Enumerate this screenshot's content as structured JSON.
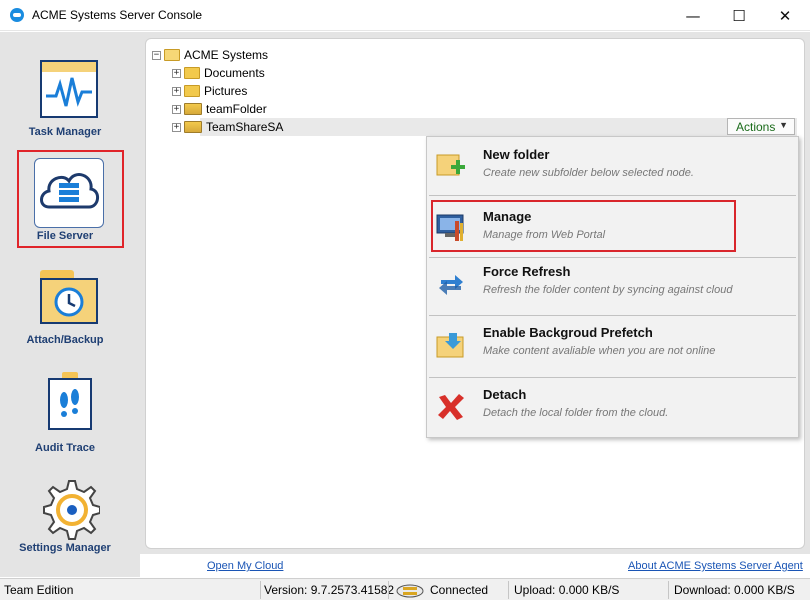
{
  "window": {
    "title": "ACME Systems Server Console",
    "controls": {
      "minimize": "—",
      "maximize": "☐",
      "close": "✕"
    }
  },
  "sidebar": {
    "items": [
      {
        "label": "Task Manager",
        "icon": "task-manager-icon"
      },
      {
        "label": "File Server",
        "icon": "file-server-icon",
        "selected": true
      },
      {
        "label": "Attach/Backup",
        "icon": "attach-backup-icon"
      },
      {
        "label": "Audit Trace",
        "icon": "audit-trace-icon"
      },
      {
        "label": "Settings Manager",
        "icon": "settings-gear-icon"
      }
    ]
  },
  "tree": {
    "root": "ACME Systems",
    "children": [
      "Documents",
      "Pictures",
      "teamFolder",
      "TeamShareSA"
    ],
    "selected": "TeamShareSA"
  },
  "actions_button": {
    "label": "Actions",
    "arrow": "▼"
  },
  "menu": {
    "items": [
      {
        "title": "New folder",
        "desc": "Create new subfolder below selected node.",
        "icon": "new-folder-icon"
      },
      {
        "title": "Manage",
        "desc": "Manage from Web Portal",
        "icon": "manage-portal-icon"
      },
      {
        "title": "Force Refresh",
        "desc": "Refresh the folder content by syncing against cloud",
        "icon": "refresh-icon"
      },
      {
        "title": "Enable Backgroud Prefetch",
        "desc": "Make content avaliable when you are not online",
        "icon": "prefetch-icon"
      },
      {
        "title": "Detach",
        "desc": "Detach the local folder from the cloud.",
        "icon": "detach-x-icon"
      }
    ]
  },
  "footer": {
    "open_cloud": "Open My Cloud",
    "about": "About ACME Systems Server Agent"
  },
  "status": {
    "edition": "Team Edition",
    "version": "Version: 9.7.2573.41582",
    "connection": "Connected",
    "upload": "Upload: 0.000 KB/S",
    "download": "Download: 0.000 KB/S"
  },
  "colors": {
    "accent_red": "#e0242a",
    "nav_label": "#1f3f73",
    "link": "#1a55b5",
    "actions_text": "#1a6b1a"
  }
}
